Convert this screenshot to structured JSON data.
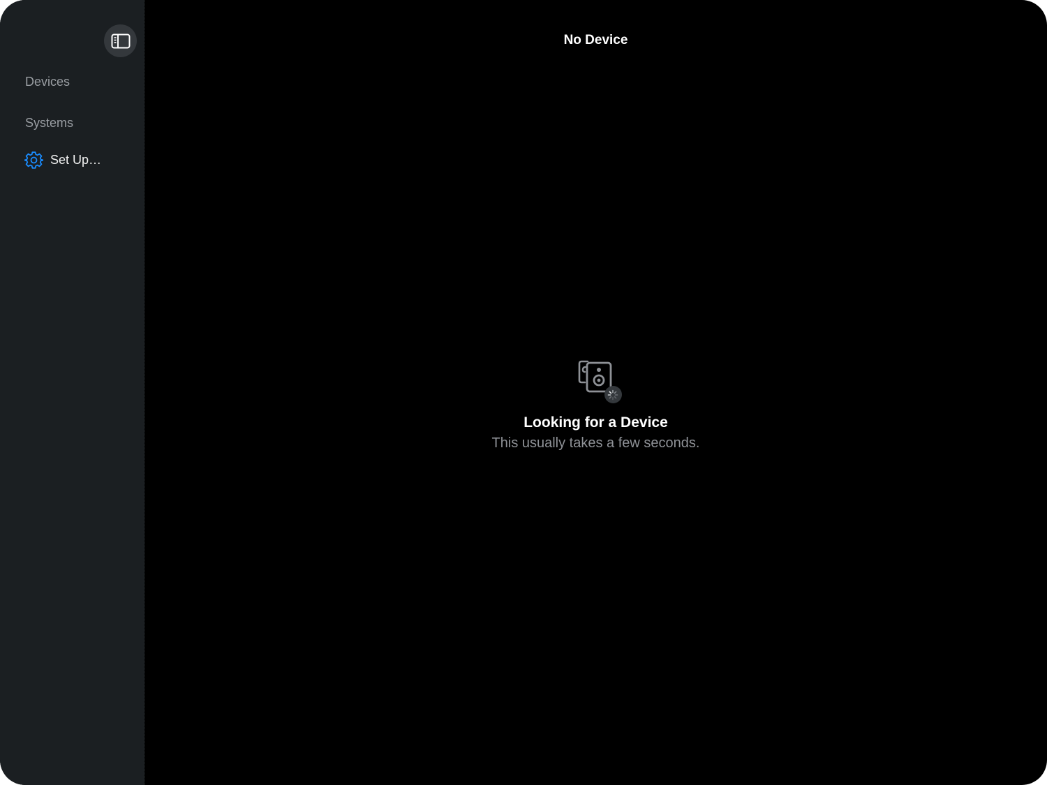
{
  "sidebar": {
    "toggle_icon": "sidebar-toggle-icon",
    "sections": {
      "devices": "Devices",
      "systems": "Systems"
    },
    "setup": {
      "label": "Set Up…",
      "icon": "gear-icon",
      "icon_color": "#1a8cff"
    }
  },
  "nav": {
    "title": "No Device"
  },
  "empty_state": {
    "icon": "speakers-icon",
    "status_icon": "activity-spinner-icon",
    "title": "Looking for a Device",
    "subtitle": "This usually takes a few seconds."
  },
  "colors": {
    "sidebar_bg": "#1b1f22",
    "main_bg": "#000000",
    "accent": "#1a8cff"
  }
}
